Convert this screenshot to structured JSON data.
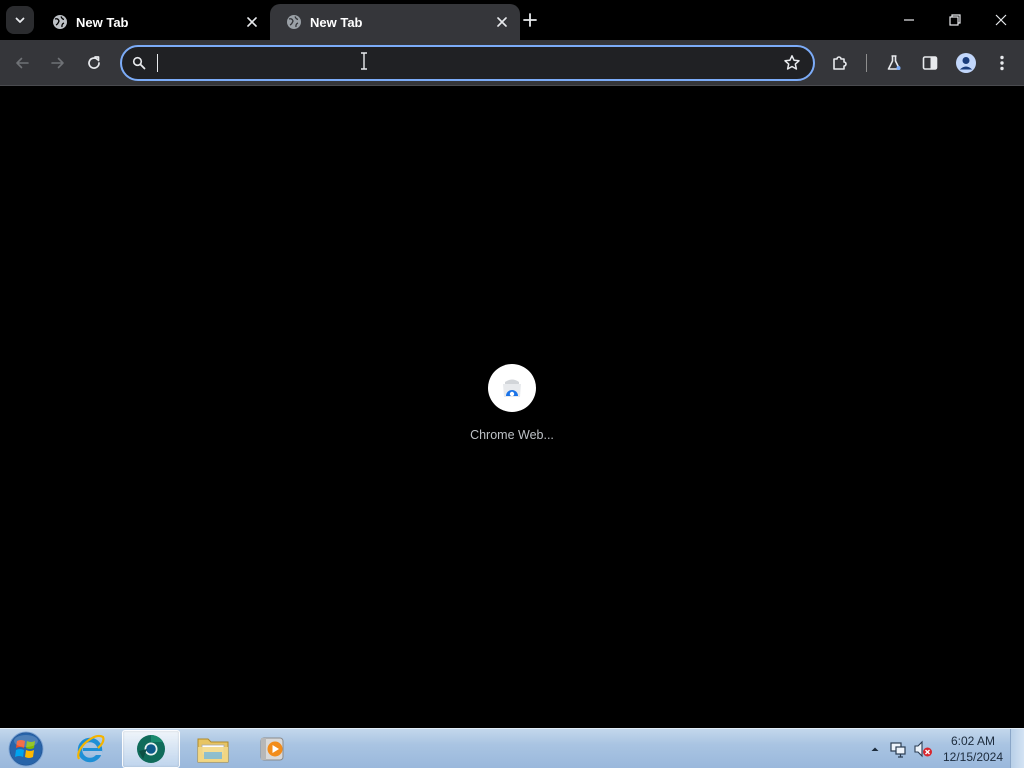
{
  "browser": {
    "tabs": [
      {
        "title": "New Tab",
        "active": false
      },
      {
        "title": "New Tab",
        "active": true
      }
    ],
    "omnibox": {
      "value": "",
      "placeholder": ""
    }
  },
  "newtab_page": {
    "shortcuts": [
      {
        "label": "Chrome Web..."
      }
    ]
  },
  "taskbar": {
    "apps": [
      "internet-explorer",
      "chrome-canary",
      "windows-explorer",
      "media-player"
    ],
    "active_app": "chrome-canary",
    "clock": {
      "time": "6:02 AM",
      "date": "12/15/2024"
    }
  },
  "theme": {
    "accent": "#7cacf8",
    "toolbar_bg": "#35363a",
    "page_bg": "#000000"
  }
}
